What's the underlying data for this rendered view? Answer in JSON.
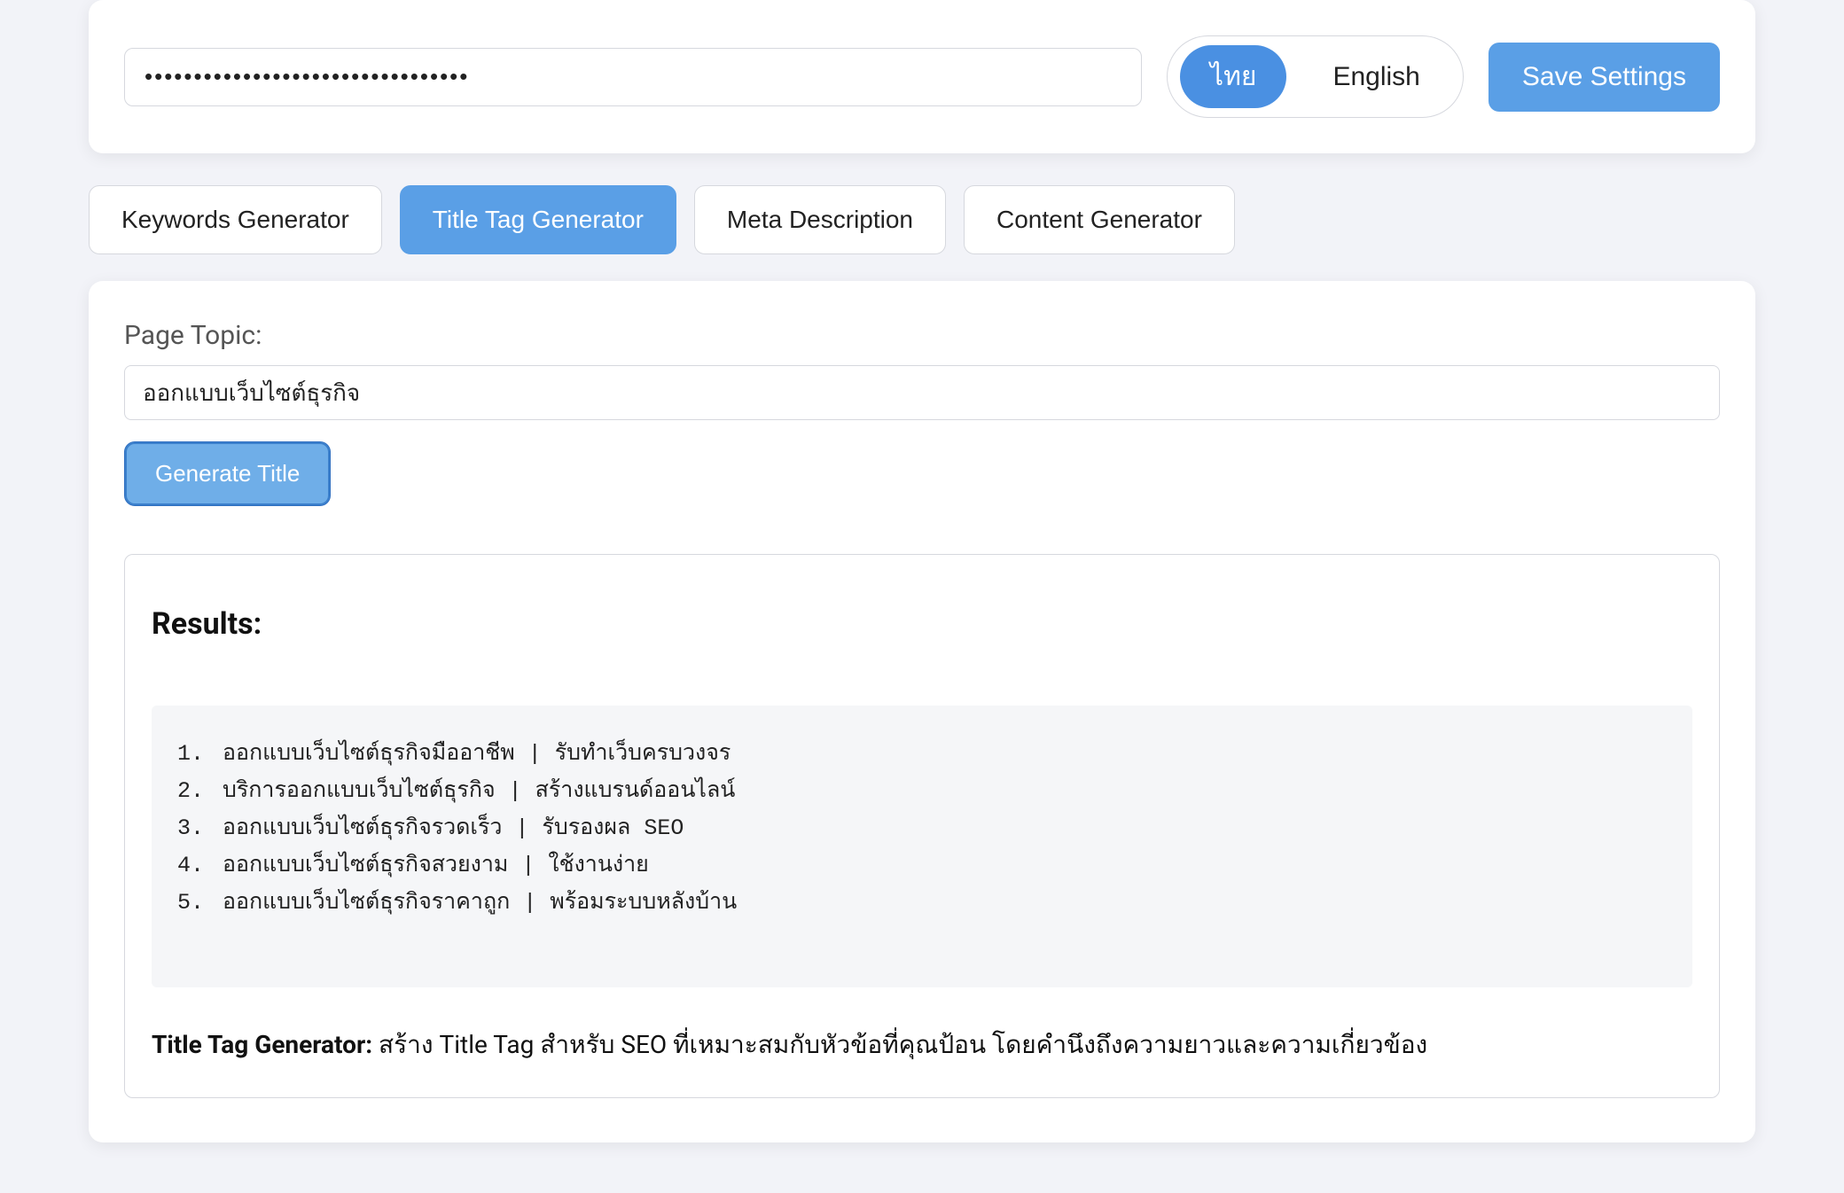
{
  "settings": {
    "api_key_masked": "•••••••••••••••••••••••••••••••••",
    "lang_thai": "ไทย",
    "lang_english": "English",
    "save_label": "Save Settings",
    "lang_active": "thai"
  },
  "tabs": [
    "Keywords Generator",
    "Title Tag Generator",
    "Meta Description",
    "Content Generator"
  ],
  "active_tab_index": 1,
  "main": {
    "topic_label": "Page Topic:",
    "topic_value": "ออกแบบเว็บไซต์ธุรกิจ",
    "generate_label": "Generate Title",
    "results_heading": "Results:",
    "results": [
      "ออกแบบเว็บไซต์ธุรกิจมืออาชีพ | รับทำเว็บครบวงจร",
      "บริการออกแบบเว็บไซต์ธุรกิจ | สร้างแบรนด์ออนไลน์",
      "ออกแบบเว็บไซต์ธุรกิจรวดเร็ว | รับรองผล SEO",
      "ออกแบบเว็บไซต์ธุรกิจสวยงาม | ใช้งานง่าย",
      "ออกแบบเว็บไซต์ธุรกิจราคาถูก | พร้อมระบบหลังบ้าน"
    ],
    "desc_title": "Title Tag Generator:",
    "desc_body": "สร้าง Title Tag สำหรับ SEO ที่เหมาะสมกับหัวข้อที่คุณป้อน โดยคำนึงถึงความยาวและความเกี่ยวข้อง"
  }
}
